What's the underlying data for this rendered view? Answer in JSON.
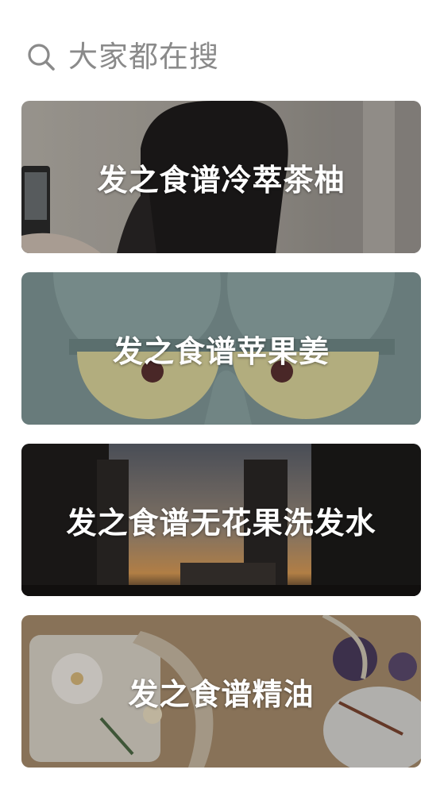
{
  "header": {
    "title": "大家都在搜",
    "icon": "search-icon"
  },
  "cards": [
    {
      "label": "发之食谱冷萃茶柚",
      "background": "hair-photo"
    },
    {
      "label": "发之食谱苹果姜",
      "background": "cartoon-eyes"
    },
    {
      "label": "发之食谱无花果洗发水",
      "background": "city-sunset"
    },
    {
      "label": "发之食谱精油",
      "background": "dried-flowers"
    }
  ],
  "colors": {
    "header_text": "#8a8a8a",
    "card_text": "#ffffff"
  }
}
